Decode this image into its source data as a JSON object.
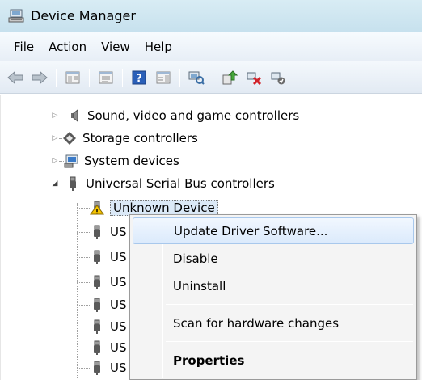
{
  "window": {
    "title": "Device Manager"
  },
  "menubar": {
    "items": [
      "File",
      "Action",
      "View",
      "Help"
    ]
  },
  "toolbar": {
    "buttons": [
      "back-icon",
      "forward-icon",
      "properties-pane-icon",
      "console-tree-icon",
      "help-icon",
      "action-pane-icon",
      "scan-hardware-icon",
      "update-driver-icon",
      "uninstall-icon",
      "disable-icon"
    ]
  },
  "tree": {
    "sound": "Sound, video and game controllers",
    "storage": "Storage controllers",
    "system": "System devices",
    "usb": "Universal Serial Bus controllers",
    "unknown": "Unknown Device",
    "usb_children": [
      "US",
      "US",
      "US",
      "US",
      "US",
      "US",
      "US"
    ]
  },
  "context_menu": {
    "items": [
      "Update Driver Software...",
      "Disable",
      "Uninstall",
      "Scan for hardware changes",
      "Properties"
    ]
  }
}
